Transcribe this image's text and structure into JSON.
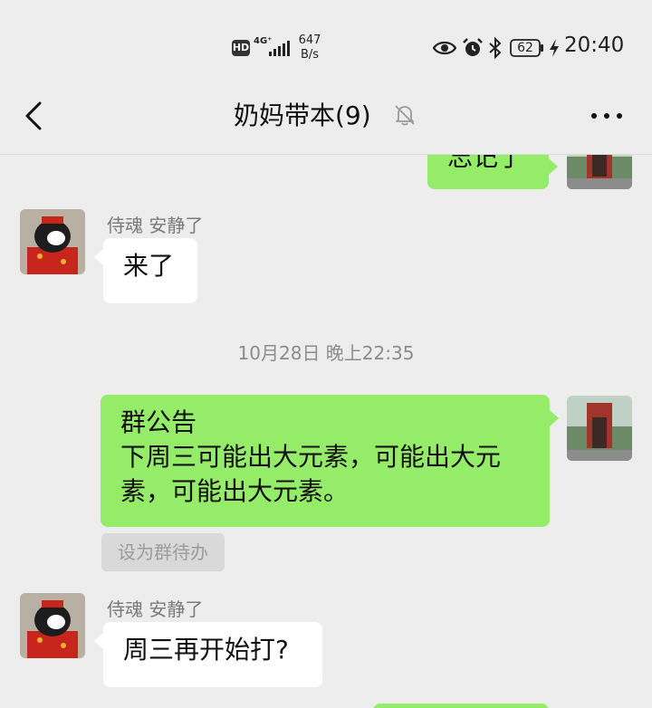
{
  "status_bar": {
    "hd": "HD",
    "network": "4G⁺",
    "speed_value": "647",
    "speed_unit": "B/s",
    "battery": "62",
    "time": "20:40",
    "icons": [
      "hd-icon",
      "signal-icon",
      "eye-icon",
      "alarm-icon",
      "bluetooth-icon",
      "battery-icon",
      "charging-icon"
    ]
  },
  "header": {
    "title": "奶妈带本(9)",
    "icons": [
      "back-icon",
      "mute-icon",
      "more-icon"
    ]
  },
  "messages": [
    {
      "type": "text",
      "direction": "out",
      "text": "忘记了"
    },
    {
      "type": "text",
      "direction": "in",
      "sender": "侍魂  安静了",
      "text": "来了"
    },
    {
      "type": "time",
      "text": "10月28日 晚上22:35"
    },
    {
      "type": "announcement",
      "direction": "out",
      "title": "群公告",
      "body": "下周三可能出大元素，可能出大元素，可能出大元素。",
      "action": "设为群待办"
    },
    {
      "type": "text",
      "direction": "in",
      "sender": "侍魂  安静了",
      "text": "周三再开始打?"
    }
  ],
  "colors": {
    "background": "#ededed",
    "bubble_out": "#95ec69",
    "bubble_in": "#ffffff"
  }
}
